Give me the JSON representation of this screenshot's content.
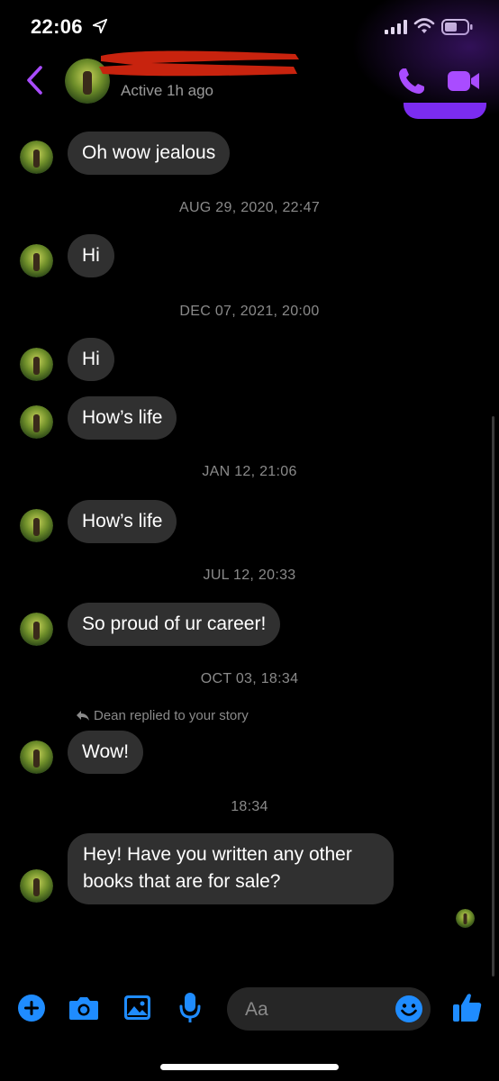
{
  "status_bar": {
    "time": "22:06"
  },
  "header": {
    "active_status": "Active 1h ago"
  },
  "messages": [
    {
      "text": "Oh wow jealous"
    },
    {
      "text": "Hi"
    },
    {
      "text": "Hi"
    },
    {
      "text": "How’s life"
    },
    {
      "text": "How’s life"
    },
    {
      "text": "So proud of ur career!"
    },
    {
      "text": "Wow!"
    },
    {
      "text": "Hey! Have you written any other books that are for sale?"
    }
  ],
  "timestamps": [
    "AUG 29, 2020, 22:47",
    "DEC 07, 2021, 20:00",
    "JAN 12, 21:06",
    "JUL 12, 20:33",
    "OCT 03, 18:34",
    "18:34"
  ],
  "story_reply_note": "Dean replied to your story",
  "composer": {
    "placeholder": "Aa"
  },
  "colors": {
    "accent_purple": "#a94cff",
    "composer_blue": "#1f8cff",
    "bubble": "#303030"
  },
  "icons": [
    "location-arrow-icon",
    "signal-icon",
    "wifi-icon",
    "battery-icon",
    "back-chevron-icon",
    "phone-icon",
    "video-icon",
    "plus-icon",
    "camera-icon",
    "gallery-icon",
    "microphone-icon",
    "emoji-icon",
    "thumbs-up-icon",
    "reply-arrow-icon"
  ]
}
